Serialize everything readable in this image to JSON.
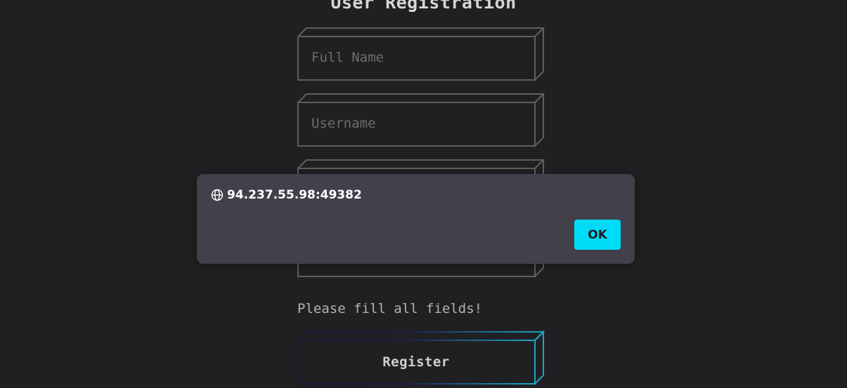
{
  "form": {
    "title": "User Registration",
    "fields": [
      {
        "placeholder": "Full Name",
        "value": ""
      },
      {
        "placeholder": "Username",
        "value": ""
      },
      {
        "placeholder": "",
        "value": ""
      },
      {
        "placeholder": "",
        "value": ""
      }
    ],
    "message": "Please fill all fields!",
    "register_label": "Register"
  },
  "dialog": {
    "origin": "94.237.55.98:49382",
    "origin_icon": "globe-icon",
    "ok_label": "OK"
  },
  "colors": {
    "background": "#202023",
    "field_stroke": "#5f5f5f",
    "dialog_background": "#42404b",
    "ok_button": "#00dcf7",
    "register_gradient_start": "#1c1838",
    "register_gradient_end": "#1aa8c4"
  }
}
